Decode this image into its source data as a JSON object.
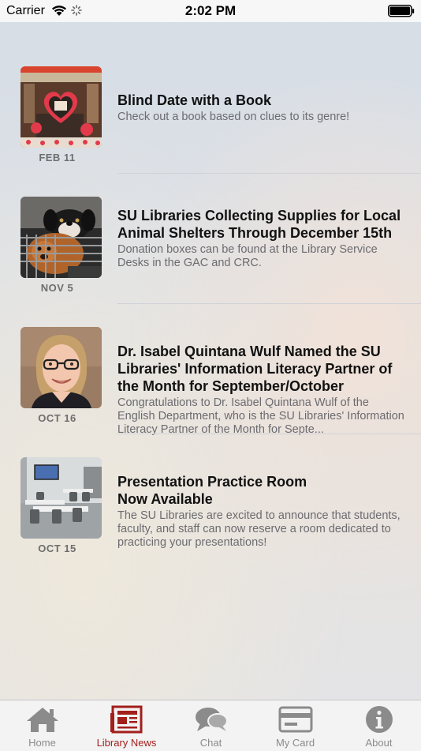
{
  "status_bar": {
    "carrier": "Carrier",
    "time": "2:02 PM"
  },
  "news": [
    {
      "title": "Blind Date with a Book",
      "description": "Check out a book based on clues to its genre!",
      "date": "FEB 11",
      "thumbnail": "valentine-books-image"
    },
    {
      "title": "SU Libraries Collecting Supplies for Local Animal Shelters Through December 15th",
      "description": "Donation boxes can be found at the Library Service Desks in the GAC and CRC.",
      "date": "NOV 5",
      "thumbnail": "puppies-image"
    },
    {
      "title": "Dr. Isabel Quintana Wulf Named the SU Libraries' Information Literacy Partner of the Month for September/October",
      "description": "Congratulations to Dr. Isabel Quintana Wulf of the English Department, who is the SU Libraries' Information Literacy Partner of the Month for Septe...",
      "date": "OCT 16",
      "thumbnail": "portrait-image"
    },
    {
      "title": "Presentation Practice Room\nNow Available",
      "description": "The SU Libraries are excited to announce that students, faculty, and staff can now reserve a room dedicated to practicing your presentations!",
      "date": "OCT 15",
      "thumbnail": "room-image"
    }
  ],
  "tabs": [
    {
      "label": "Home",
      "icon": "home-icon",
      "active": false
    },
    {
      "label": "Library News",
      "icon": "newspaper-icon",
      "active": true
    },
    {
      "label": "Chat",
      "icon": "chat-icon",
      "active": false
    },
    {
      "label": "My Card",
      "icon": "card-icon",
      "active": false
    },
    {
      "label": "About",
      "icon": "info-icon",
      "active": false
    }
  ],
  "colors": {
    "accent": "#a31f1a",
    "inactive": "#8b8b8b"
  }
}
